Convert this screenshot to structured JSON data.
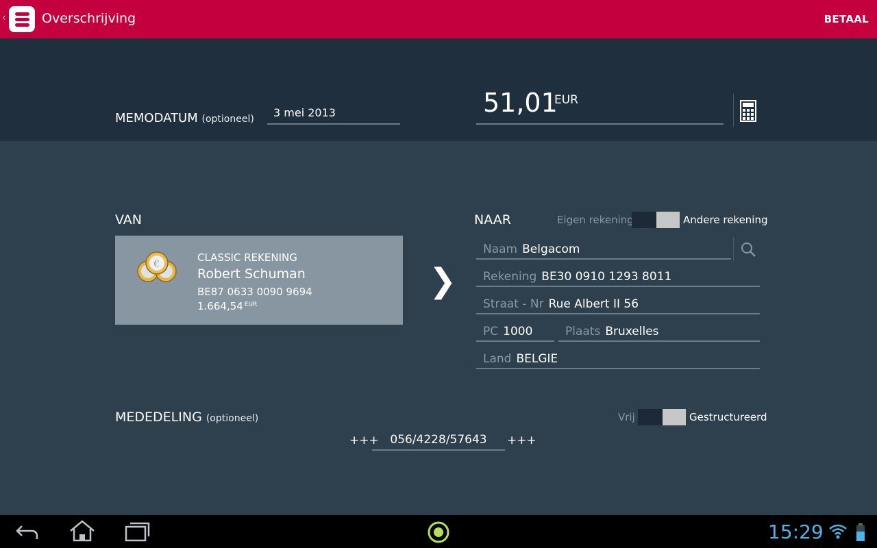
{
  "app": {
    "title": "Overschrijving",
    "pay_label": "BETAAL",
    "brand_color": "#c4003e"
  },
  "memo": {
    "label": "MEMODATUM",
    "optional": "(optioneel)",
    "date_value": "3 mei 2013"
  },
  "amount": {
    "value": "51,01",
    "currency": "EUR"
  },
  "from": {
    "label": "VAN",
    "account_type": "CLASSIC REKENING",
    "holder": "Robert Schuman",
    "iban": "BE87 0633 0090 9694",
    "balance": "1.664,54",
    "balance_currency": "EUR"
  },
  "to": {
    "label": "NAAR",
    "toggle_off_label": "Eigen rekening",
    "toggle_on_label": "Andere rekening",
    "fields": {
      "name_label": "Naam",
      "name_value": "Belgacom",
      "account_label": "Rekening",
      "account_value": "BE30 0910 1293 8011",
      "street_label": "Straat - Nr",
      "street_value": "Rue Albert II 56",
      "postcode_label": "PC",
      "postcode_value": "1000",
      "city_label": "Plaats",
      "city_value": "Bruxelles",
      "country_label": "Land",
      "country_value": "BELGIE"
    }
  },
  "message": {
    "label": "MEDEDELING",
    "optional": "(optioneel)",
    "toggle_off_label": "Vrij",
    "toggle_on_label": "Gestructureerd",
    "prefix": "+++",
    "structured_value": "056/4228/57643",
    "suffix": "+++"
  },
  "statusbar": {
    "time": "15:29",
    "clock_color": "#4fb4e6"
  },
  "icons": [
    "back-icon",
    "home-icon",
    "recent-apps-icon",
    "launcher-icon",
    "wifi-icon",
    "battery-icon",
    "calculator-icon",
    "search-icon",
    "coins-icon"
  ]
}
